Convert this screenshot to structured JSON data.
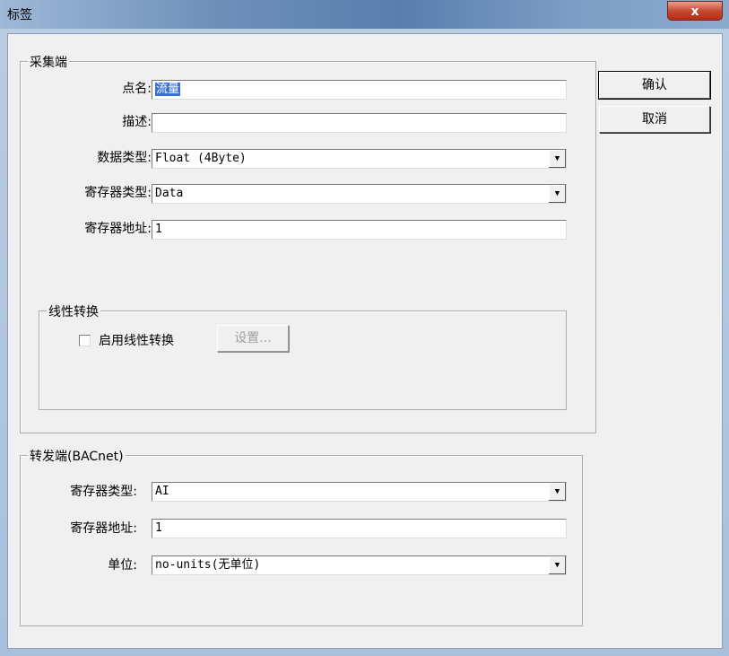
{
  "window": {
    "title": "标签",
    "close_glyph": "x"
  },
  "buttons": {
    "ok": "确认",
    "cancel": "取消"
  },
  "collector": {
    "legend": "采集端",
    "point_name_label": "点名:",
    "point_name_value": "流量",
    "description_label": "描述:",
    "description_value": "",
    "data_type_label": "数据类型:",
    "data_type_value": "Float (4Byte)",
    "register_type_label": "寄存器类型:",
    "register_type_value": "Data",
    "register_addr_label": "寄存器地址:",
    "register_addr_value": "1"
  },
  "linear": {
    "legend": "线性转换",
    "enable_label": "启用线性转换",
    "enable_checked": false,
    "settings_button": "设置..."
  },
  "forwarder": {
    "legend": "转发端(BACnet)",
    "register_type_label": "寄存器类型:",
    "register_type_value": "AI",
    "register_addr_label": "寄存器地址:",
    "register_addr_value": "1",
    "unit_label": "单位:",
    "unit_value": "no-units(无单位)"
  }
}
